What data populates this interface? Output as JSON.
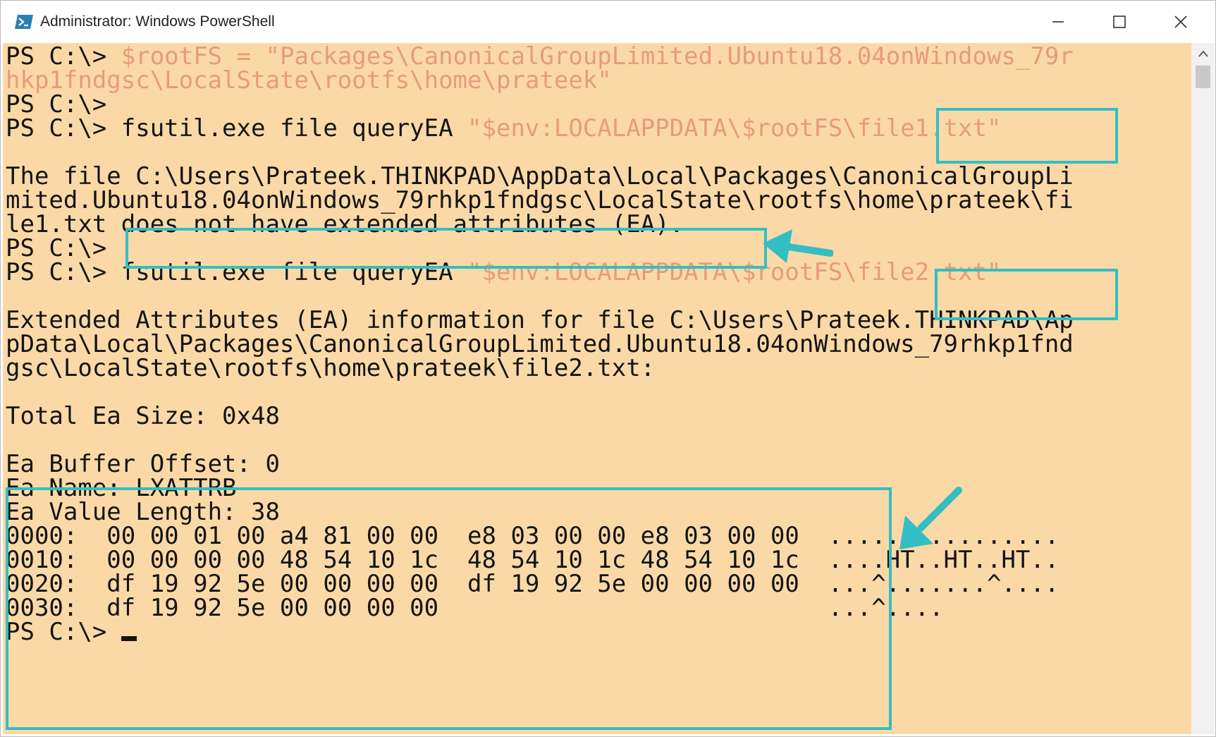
{
  "window": {
    "title": "Administrator: Windows PowerShell",
    "controls": {
      "minimize": "minimize-icon",
      "maximize": "maximize-icon",
      "close": "close-icon"
    }
  },
  "colors": {
    "console_bg": "#fbd9a7",
    "text": "#141414",
    "string": "#e59b7e",
    "highlight": "#33bec3"
  },
  "console": {
    "line1": {
      "prompt": "PS C:\\> ",
      "variable": "$rootFS",
      "op": " = ",
      "string_a": "\"Packages\\CanonicalGroupLimited.Ubuntu18.04onWindows_79r"
    },
    "line2": {
      "string_b": "hkp1fndgsc\\LocalState\\rootfs\\home\\prateek\""
    },
    "line3": {
      "prompt": "PS C:\\>"
    },
    "line4": {
      "prompt": "PS C:\\> ",
      "cmd": "fsutil.exe",
      "args": " file queryEA ",
      "string_a": "\"$env:LOCALAPPDATA\\$rootFS\\",
      "string_file": "file1.txt\""
    },
    "line5": {
      "text": "The file C:\\Users\\Prateek.THINKPAD\\AppData\\Local\\Packages\\CanonicalGroupLi"
    },
    "line6": {
      "text": "mited.Ubuntu18.04onWindows_79rhkp1fndgsc\\LocalState\\rootfs\\home\\prateek\\fi"
    },
    "line7": {
      "text": "le1.txt does not have extended attributes (EA)."
    },
    "line8": {
      "prompt": "PS C:\\>"
    },
    "line9": {
      "prompt": "PS C:\\> ",
      "cmd": "fsutil.exe",
      "args": " file queryEA ",
      "string_a": "\"$env:LOCALAPPDATA\\$rootFS\\",
      "string_file": "file2.txt\""
    },
    "line10": {
      "text": "Extended Attributes (EA) information for file C:\\Users\\Prateek.THINKPAD\\Ap"
    },
    "line11": {
      "text": "pData\\Local\\Packages\\CanonicalGroupLimited.Ubuntu18.04onWindows_79rhkp1fnd"
    },
    "line12": {
      "text": "gsc\\LocalState\\rootfs\\home\\prateek\\file2.txt:"
    },
    "line13": {
      "text": "Total Ea Size: 0x48"
    },
    "line14": {
      "text": "Ea Buffer Offset: 0"
    },
    "line15": {
      "text": "Ea Name: LXATTRB"
    },
    "line16": {
      "text": "Ea Value Length: 38"
    },
    "hex_rows": [
      {
        "offset": "0000:",
        "bytes": "  00 00 01 00 a4 81 00 00  e8 03 00 00 e8 03 00 00",
        "ascii": "  ................"
      },
      {
        "offset": "0010:",
        "bytes": "  00 00 00 00 48 54 10 1c  48 54 10 1c 48 54 10 1c",
        "ascii": "  ....HT..HT..HT.."
      },
      {
        "offset": "0020:",
        "bytes": "  df 19 92 5e 00 00 00 00  df 19 92 5e 00 00 00 00",
        "ascii": "  ...^.......^...."
      },
      {
        "offset": "0030:",
        "bytes": "  df 19 92 5e 00 00 00 00",
        "ascii": "                           ...^...."
      }
    ],
    "line21": {
      "prompt": "PS C:\\> "
    }
  }
}
